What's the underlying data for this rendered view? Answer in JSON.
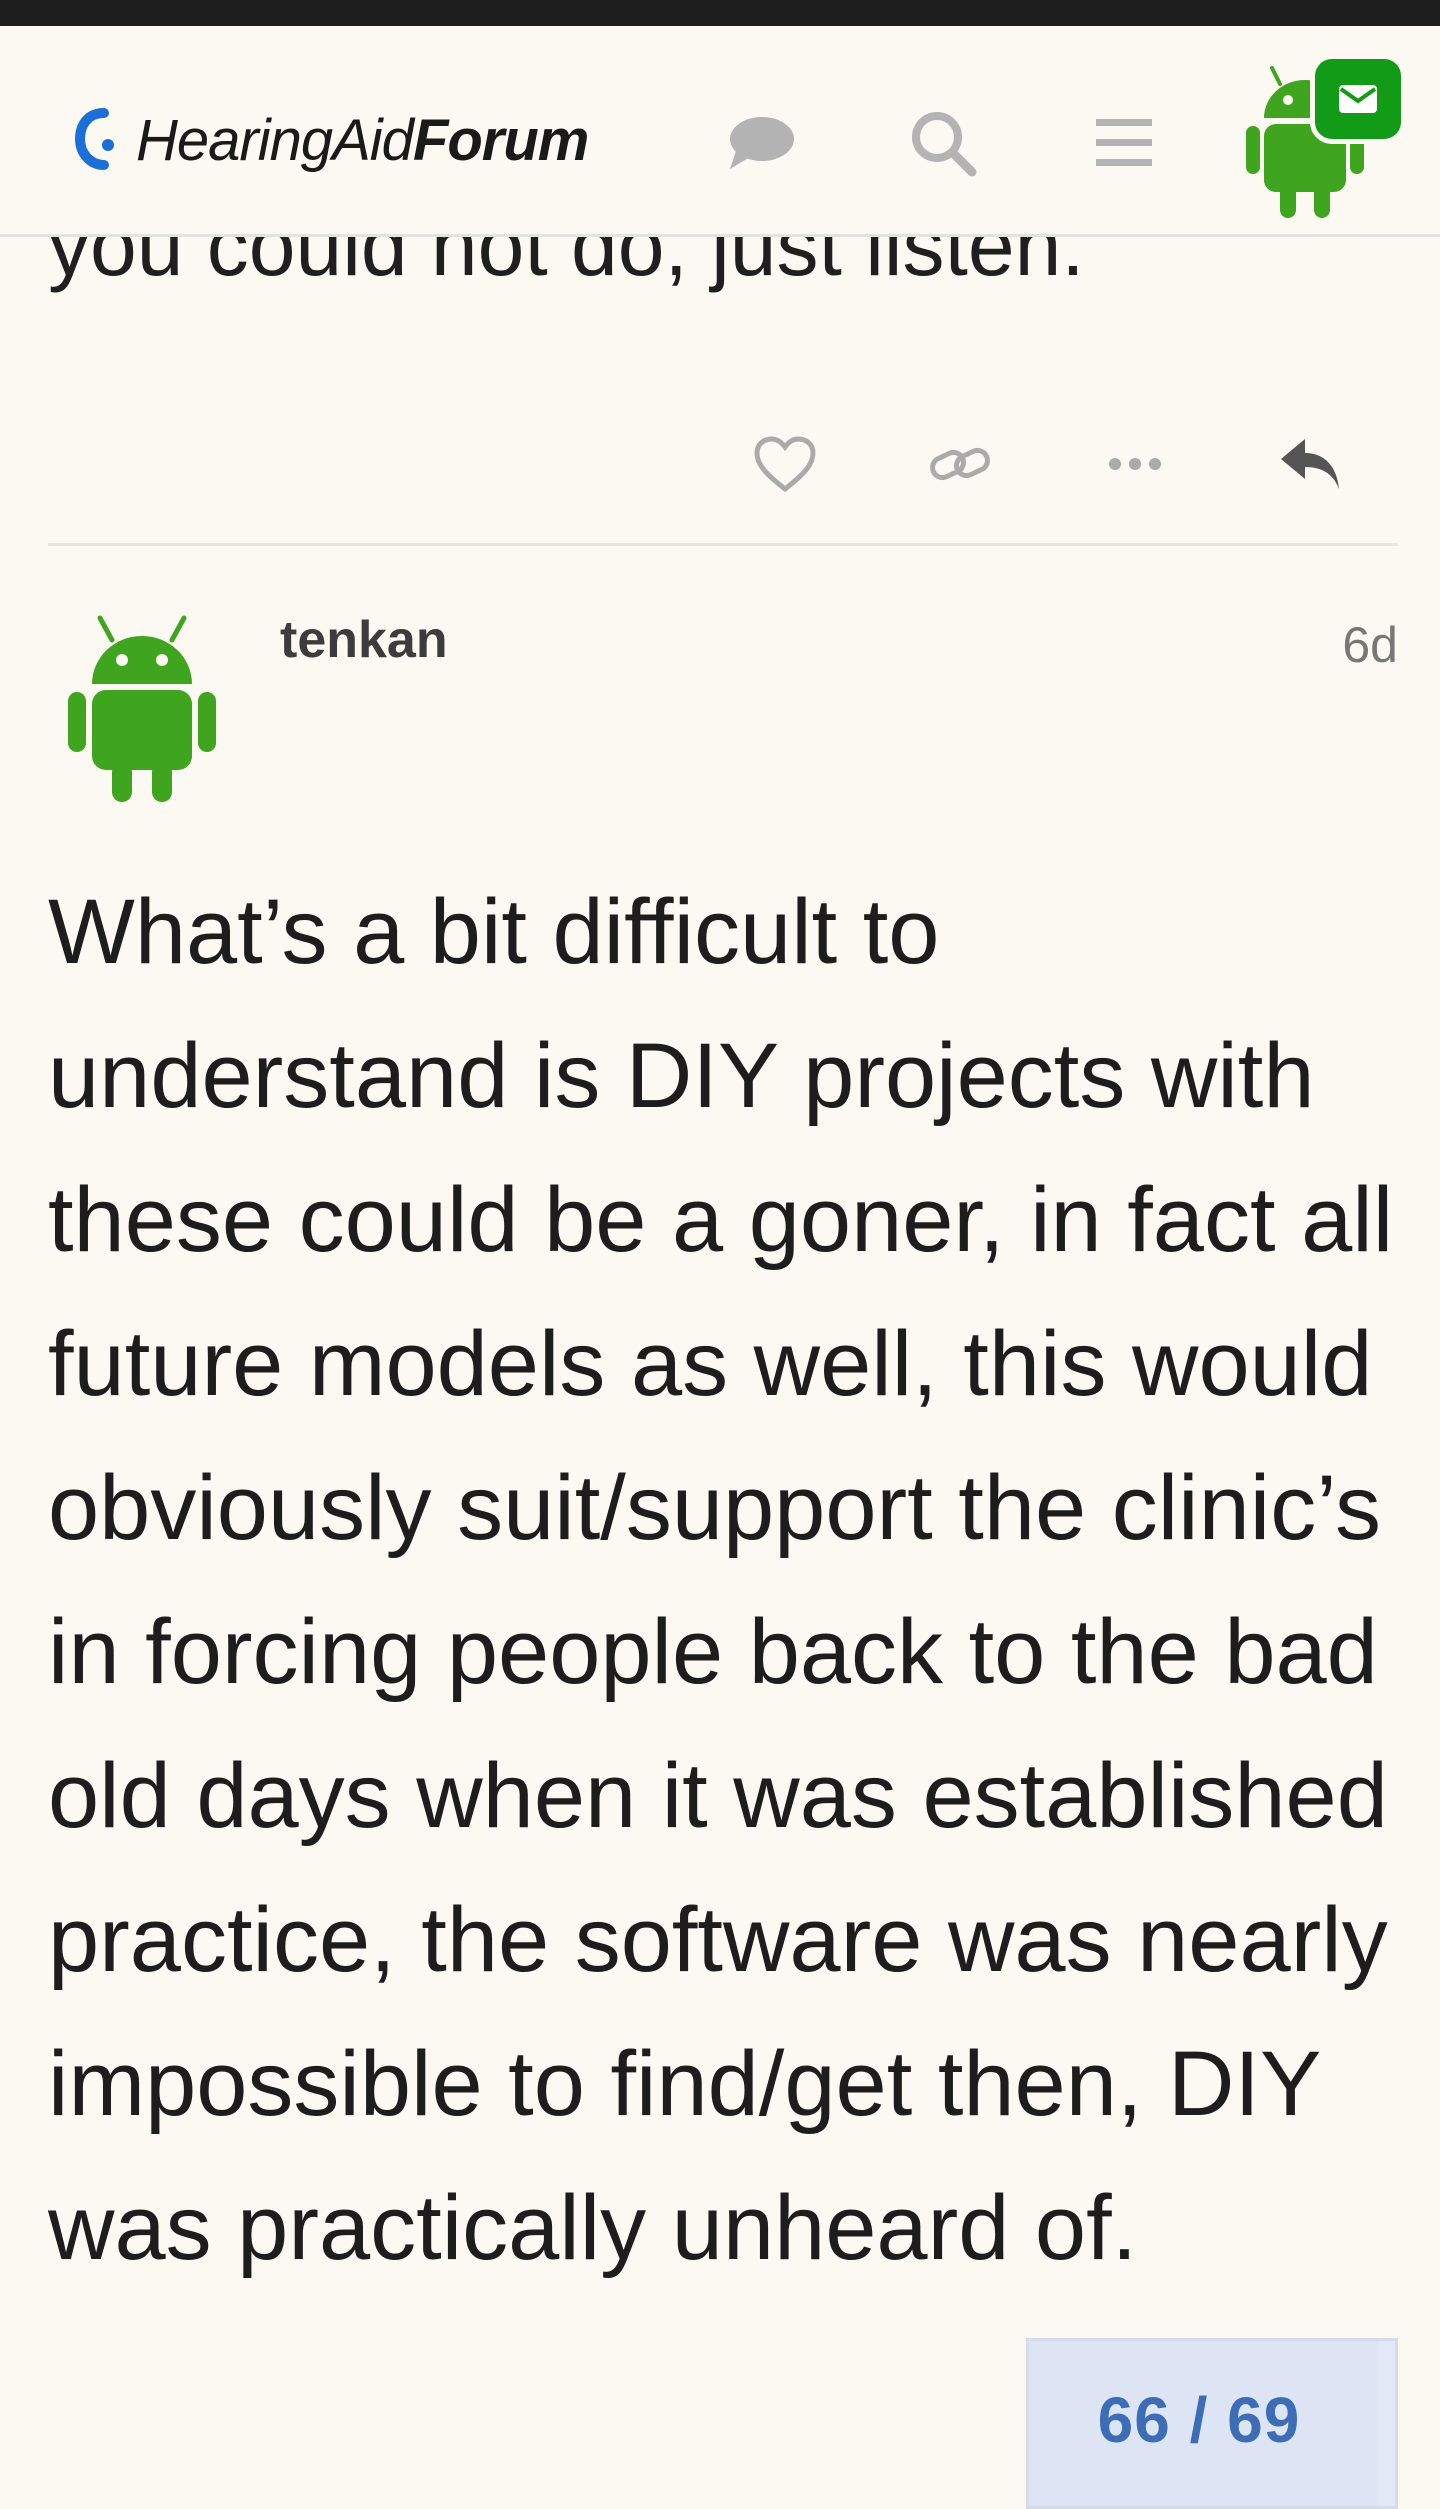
{
  "header": {
    "logo_light": "HearingAid",
    "logo_bold": "Forum"
  },
  "previous_post": {
    "trailing_text": "you could not do, just listen."
  },
  "post": {
    "username": "tenkan",
    "date": "6d",
    "body": "What’s a bit difficult to understand is DIY projects with these could be a goner, in fact all future models as well, this would obviously suit/support the clinic’s in forcing people back to the bad old days when it was established practice, the software was nearly impossible to find/get then, DIY was practically unheard of."
  },
  "timeline": {
    "position_label": "66 / 69",
    "fraction": 0.956
  },
  "colors": {
    "background": "#fcf9f3",
    "accent_blue": "#3d6db4",
    "badge_green": "#119b16",
    "android_green": "#3fa51f"
  },
  "icons": [
    "chat-icon",
    "search-icon",
    "hamburger-menu-icon",
    "mail-icon",
    "heart-icon",
    "link-icon",
    "more-icon",
    "reply-icon"
  ]
}
